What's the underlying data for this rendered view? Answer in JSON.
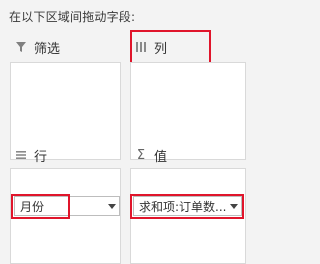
{
  "instruction": "在以下区域间拖动字段:",
  "areas": {
    "filter": {
      "label": "筛选",
      "icon": "filter-icon"
    },
    "columns": {
      "label": "列",
      "icon": "columns-icon"
    },
    "rows": {
      "label": "行",
      "icon": "rows-icon",
      "field": "月份"
    },
    "values": {
      "label": "值",
      "icon": "sigma-icon",
      "symbol": "Σ",
      "field": "求和项:订单数..."
    }
  },
  "highlight_color": "#e0152b"
}
